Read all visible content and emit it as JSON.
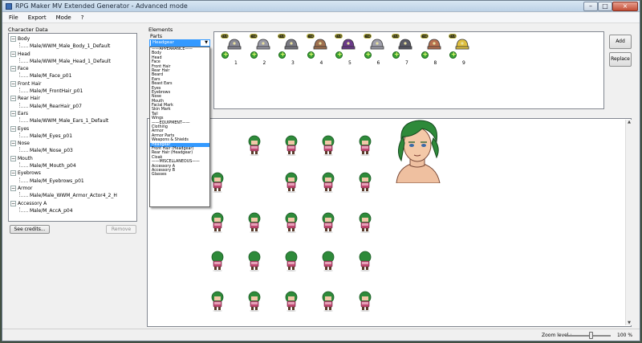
{
  "window": {
    "title": "RPG Maker MV Extended Generator - Advanced mode",
    "min_glyph": "–",
    "max_glyph": "□",
    "close_glyph": "×"
  },
  "menu": [
    "File",
    "Export",
    "Mode",
    "?"
  ],
  "character_data": {
    "label": "Character Data",
    "nodes": [
      {
        "name": "Body",
        "value": "Male/WWM_Male_Body_1_Default"
      },
      {
        "name": "Head",
        "value": "Male/WWM_Male_Head_1_Default"
      },
      {
        "name": "Face",
        "value": "Male/M_Face_p01"
      },
      {
        "name": "Front Hair",
        "value": "Male/M_FrontHair_p01"
      },
      {
        "name": "Rear Hair",
        "value": "Male/M_RearHair_p07"
      },
      {
        "name": "Ears",
        "value": "Male/WWM_Male_Ears_1_Default"
      },
      {
        "name": "Eyes",
        "value": "Male/M_Eyes_p01"
      },
      {
        "name": "Nose",
        "value": "Male/M_Nose_p03"
      },
      {
        "name": "Mouth",
        "value": "Male/M_Mouth_p04"
      },
      {
        "name": "Eyebrows",
        "value": "Male/M_Eyebrows_p01"
      },
      {
        "name": "Armor",
        "value": "Male/Male_WWM_Armor_Actor4_2_H"
      },
      {
        "name": "Accessory A",
        "value": "Male/M_AccA_p04"
      }
    ],
    "expander_glyph": "−",
    "see_credits": "See credits...",
    "remove": "Remove"
  },
  "elements": {
    "label": "Elements",
    "parts_label": "Parts",
    "parts_selected": "Headgear",
    "combo_arrow": "▼",
    "dropdown": [
      "——APPEARANCE——",
      "Body",
      "Head",
      "Face",
      "Front Hair",
      "Rear Hair",
      "Beard",
      "Ears",
      "Beast Ears",
      "Eyes",
      "Eyebrows",
      "Nose",
      "Mouth",
      "Facial Mark",
      "Skin Mark",
      "Tail",
      "Wings",
      "——EQUIPMENT——",
      "Clothing",
      "Armor",
      "Armor Parts",
      "Weapons & Shields",
      "Headgear",
      "Front Hair (Headgear)",
      "Rear Hair (Headgear)",
      "Cloak",
      "——MISCELLANEOUS——",
      "Accessory A",
      "Accessory B",
      "Glasses"
    ],
    "dropdown_highlight_index": 22,
    "parts": [
      {
        "num": "1",
        "tag": "T+A",
        "color": "#8a8a96"
      },
      {
        "num": "2",
        "tag": "T+A",
        "color": "#9a9aa6"
      },
      {
        "num": "3",
        "tag": "T+A",
        "color": "#7a7a84"
      },
      {
        "num": "4",
        "tag": "T+A",
        "color": "#a07050"
      },
      {
        "num": "5",
        "tag": "T+A",
        "color": "#6a3a8a"
      },
      {
        "num": "6",
        "tag": "T+A",
        "color": "#a0a0ac"
      },
      {
        "num": "7",
        "tag": "T+A",
        "color": "#5a5a66"
      },
      {
        "num": "8",
        "tag": "T+A",
        "color": "#b87050"
      },
      {
        "num": "9",
        "tag": "T+A",
        "color": "#e0c040"
      }
    ],
    "add": "Add",
    "replace": "Replace"
  },
  "preview": {
    "scroll_up": "▲",
    "scroll_down": "▼",
    "colors": {
      "hair": "#2e8a3a",
      "hair_dark": "#1a5a24",
      "skin": "#f2c8a8",
      "body": "#c04870",
      "armor": "#e6a0b8",
      "boots": "#5a3a2a"
    }
  },
  "status": {
    "zoom_label": "Zoom level :",
    "zoom_value": "100 %",
    "zoom_fraction": 0.55
  }
}
